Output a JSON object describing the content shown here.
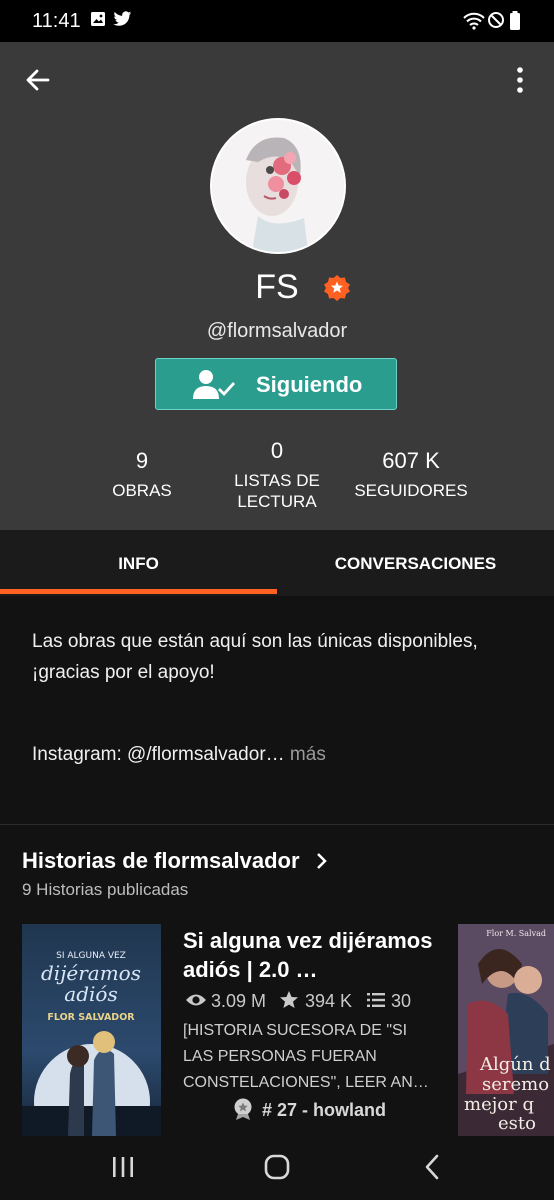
{
  "status_bar": {
    "time": "11:41"
  },
  "profile": {
    "name": "FS",
    "handle": "@flormsalvador",
    "follow_label": "Siguiendo",
    "stats": [
      {
        "number": "9",
        "label": "OBRAS"
      },
      {
        "number": "0",
        "label": "LISTAS DE LECTURA"
      },
      {
        "number": "607 K",
        "label": "SEGUIDORES"
      }
    ]
  },
  "tabs": [
    {
      "label": "INFO",
      "active": true
    },
    {
      "label": "CONVERSACIONES",
      "active": false
    }
  ],
  "about": {
    "description": "Las obras que están aquí son las únicas disponibles, ¡gracias por el apoyo!",
    "instagram": "Instagram: @/flormsalvador…",
    "more_label": "más"
  },
  "stories": {
    "title": "Historias de flormsalvador",
    "count_label": "9 Historias publicadas",
    "items": [
      {
        "title": "Si alguna vez dijéramos adiós | 2.0 …",
        "reads": "3.09 M",
        "votes": "394 K",
        "parts": "30",
        "description": "[HISTORIA SUCESORA DE \"SI LAS PERSONAS FUERAN CONSTELACIONES\", LEER AN…",
        "rank": "# 27 - howland",
        "cover_lines": [
          "SI ALGUNA VEZ",
          "dijéramos",
          "adiós",
          "FLOR SALVADOR"
        ]
      }
    ],
    "next_cover": {
      "author": "Flor M. Salvad",
      "lines": [
        "Algún d",
        "seremo",
        "mejor q",
        "esto"
      ]
    }
  },
  "colors": {
    "accent": "#ff6122",
    "follow_button": "#2a9d8f",
    "header_bg": "#3a3a3a"
  },
  "icons": [
    "back-arrow-icon",
    "more-vertical-icon",
    "star-badge-icon",
    "user-check-icon",
    "eye-icon",
    "star-icon",
    "list-icon",
    "chevron-right-icon",
    "rank-badge-icon",
    "recents-icon",
    "home-icon",
    "back-nav-icon"
  ]
}
